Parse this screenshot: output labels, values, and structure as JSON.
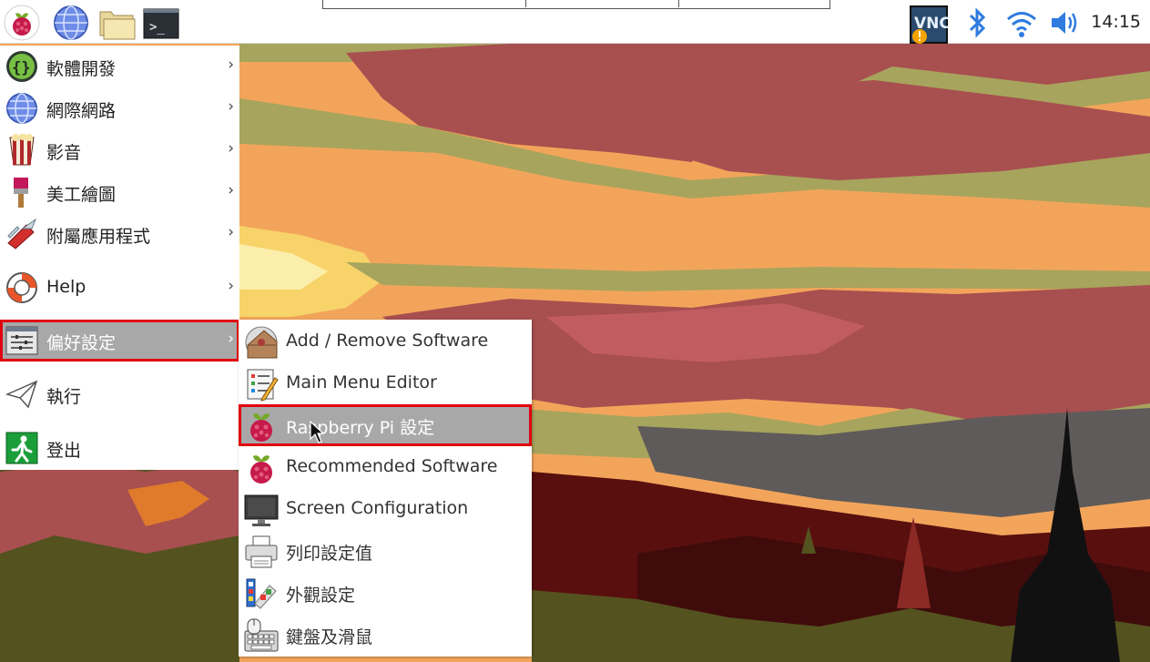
{
  "taskbar": {
    "icons": [
      "raspberry-menu-icon",
      "web-browser-icon",
      "file-manager-icon",
      "terminal-icon"
    ],
    "tray": [
      "vnc-icon",
      "bluetooth-icon",
      "wifi-icon",
      "volume-icon"
    ],
    "vnc_label": "VNC",
    "terminal_glyph": ">_",
    "clock": "14:15"
  },
  "main_menu": {
    "items": [
      {
        "label": "軟體開發",
        "icon": "programming-icon",
        "has_submenu": true
      },
      {
        "label": "網際網路",
        "icon": "internet-icon",
        "has_submenu": true
      },
      {
        "label": "影音",
        "icon": "sound-video-icon",
        "has_submenu": true
      },
      {
        "label": "美工繪圖",
        "icon": "graphics-icon",
        "has_submenu": true
      },
      {
        "label": "附屬應用程式",
        "icon": "accessories-icon",
        "has_submenu": true
      },
      {
        "label": "Help",
        "icon": "help-icon",
        "has_submenu": true
      },
      {
        "label": "偏好設定",
        "icon": "preferences-icon",
        "has_submenu": true
      },
      {
        "label": "執行",
        "icon": "run-icon",
        "has_submenu": false
      },
      {
        "label": "登出",
        "icon": "logout-icon",
        "has_submenu": false
      }
    ],
    "arrow": "›",
    "selected": "偏好設定"
  },
  "sub_menu": {
    "items": [
      {
        "label": "Add / Remove Software",
        "icon": "add-remove-software-icon"
      },
      {
        "label": "Main Menu Editor",
        "icon": "main-menu-editor-icon"
      },
      {
        "label": "Raspberry Pi 設定",
        "icon": "raspberry-config-icon"
      },
      {
        "label": "Recommended Software",
        "icon": "recommended-software-icon"
      },
      {
        "label": "Screen Configuration",
        "icon": "screen-config-icon"
      },
      {
        "label": "列印設定值",
        "icon": "printer-icon"
      },
      {
        "label": "外觀設定",
        "icon": "appearance-icon"
      },
      {
        "label": "鍵盤及滑鼠",
        "icon": "keyboard-mouse-icon"
      }
    ],
    "selected": "Raspberry Pi 設定"
  },
  "colors": {
    "highlight_border": "#e0000f",
    "highlight_bg": "#a8a8a8",
    "raspberry_red": "#c51a4a",
    "raspberry_green": "#75a928"
  }
}
